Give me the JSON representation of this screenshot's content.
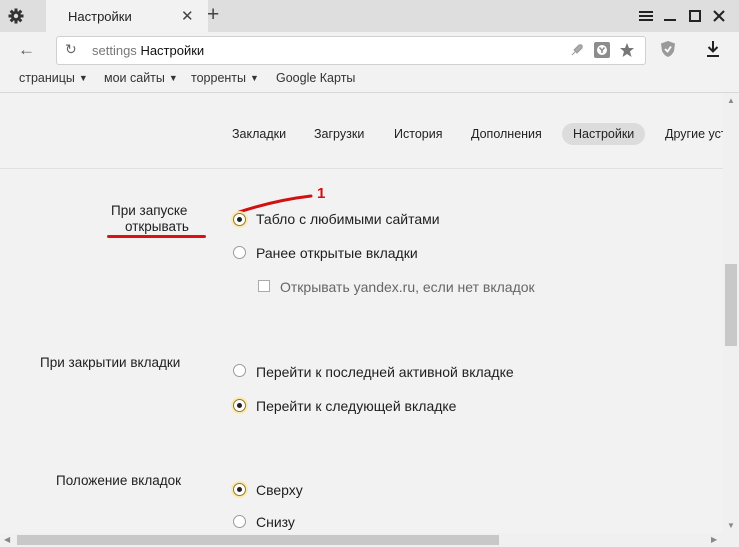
{
  "tab": {
    "title": "Настройки"
  },
  "address": {
    "scheme": "settings",
    "title": "Настройки"
  },
  "bookmarks": [
    {
      "label": "страницы",
      "dropdown": true
    },
    {
      "label": "мои сайты",
      "dropdown": true
    },
    {
      "label": "торренты",
      "dropdown": true
    },
    {
      "label": "Google Карты",
      "dropdown": false
    }
  ],
  "subnav": {
    "items": [
      "Закладки",
      "Загрузки",
      "История",
      "Дополнения",
      "Настройки",
      "Другие устро"
    ],
    "active": "Настройки"
  },
  "startup": {
    "label_line1": "При запуске",
    "label_line2": "открывать",
    "annotation_number": "1",
    "options": [
      {
        "label": "Табло с любимыми сайтами",
        "selected": true
      },
      {
        "label": "Ранее открытые вкладки",
        "selected": false
      }
    ],
    "sub_checkbox": {
      "label": "Открывать yandex.ru, если нет вкладок",
      "checked": false
    }
  },
  "tab_close": {
    "label": "При закрытии вкладки",
    "options": [
      {
        "label": "Перейти к последней активной вкладке",
        "selected": false
      },
      {
        "label": "Перейти к следующей вкладке",
        "selected": true
      }
    ]
  },
  "tab_position": {
    "label": "Положение вкладок",
    "options": [
      {
        "label": "Сверху",
        "selected": true
      },
      {
        "label": "Снизу",
        "selected": false
      }
    ]
  },
  "colors": {
    "accent_annotation": "#d11111",
    "radio_highlight": "#fde9a7"
  }
}
